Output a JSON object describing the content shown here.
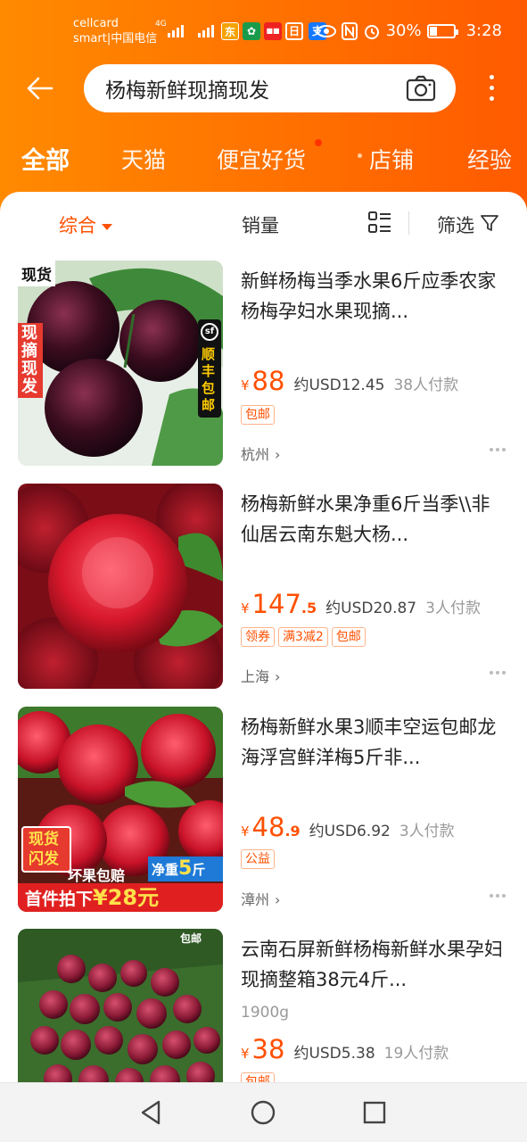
{
  "status": {
    "carrier_line1": "cellcard",
    "carrier_line2": "smart|中国电信",
    "network": "4G",
    "battery_text": "30%",
    "battery_level": 0.3,
    "time": "3:28"
  },
  "search": {
    "query": "杨梅新鲜现摘现发"
  },
  "tabs": [
    {
      "label": "全部",
      "active": true
    },
    {
      "label": "天猫"
    },
    {
      "label": "便宜好货"
    },
    {
      "label": "店铺"
    },
    {
      "label": "经验"
    }
  ],
  "sort": {
    "overall": "综合",
    "sales": "销量",
    "filter": "筛选"
  },
  "products": [
    {
      "title": "新鲜杨梅当季水果6斤应季农家杨梅孕妇水果现摘...",
      "price_int": "88",
      "price_dec": "",
      "usd": "约USD12.45",
      "sold": "38人付款",
      "tags": [
        "包邮"
      ],
      "location": "杭州",
      "thumb_text": {
        "stock": "现货",
        "fresh": "现摘现发",
        "sf": "顺丰包邮",
        "sf_logo": "sf"
      }
    },
    {
      "title": "杨梅新鲜水果净重6斤当季\\\\非仙居云南东魁大杨...",
      "price_int": "147",
      "price_dec": ".5",
      "usd": "约USD20.87",
      "sold": "3人付款",
      "tags": [
        "领券",
        "满3减2",
        "包邮"
      ],
      "location": "上海"
    },
    {
      "title": "杨梅新鲜水果3顺丰空运包邮龙海浮宫鲜洋梅5斤非...",
      "price_int": "48",
      "price_dec": ".9",
      "usd": "约USD6.92",
      "sold": "3人付款",
      "tags": [
        "公益"
      ],
      "location": "漳州",
      "thumb_text": {
        "stock": "现货闪发",
        "guarantee": "坏果包赔",
        "net": "净重",
        "net_num": "5",
        "net_unit": "斤",
        "first": "首件拍下",
        "first_price": "¥28元"
      }
    },
    {
      "title": "云南石屏新鲜杨梅新鲜水果孕妇现摘整箱38元4斤...",
      "spec": "1900g",
      "price_int": "38",
      "price_dec": "",
      "usd": "约USD5.38",
      "sold": "19人付款",
      "tags": [
        "包邮"
      ],
      "thumb_text": {
        "free": "包邮"
      }
    }
  ],
  "colors": {
    "accent": "#ff5000",
    "header_from": "#ff8a00",
    "header_to": "#ff5a00"
  }
}
